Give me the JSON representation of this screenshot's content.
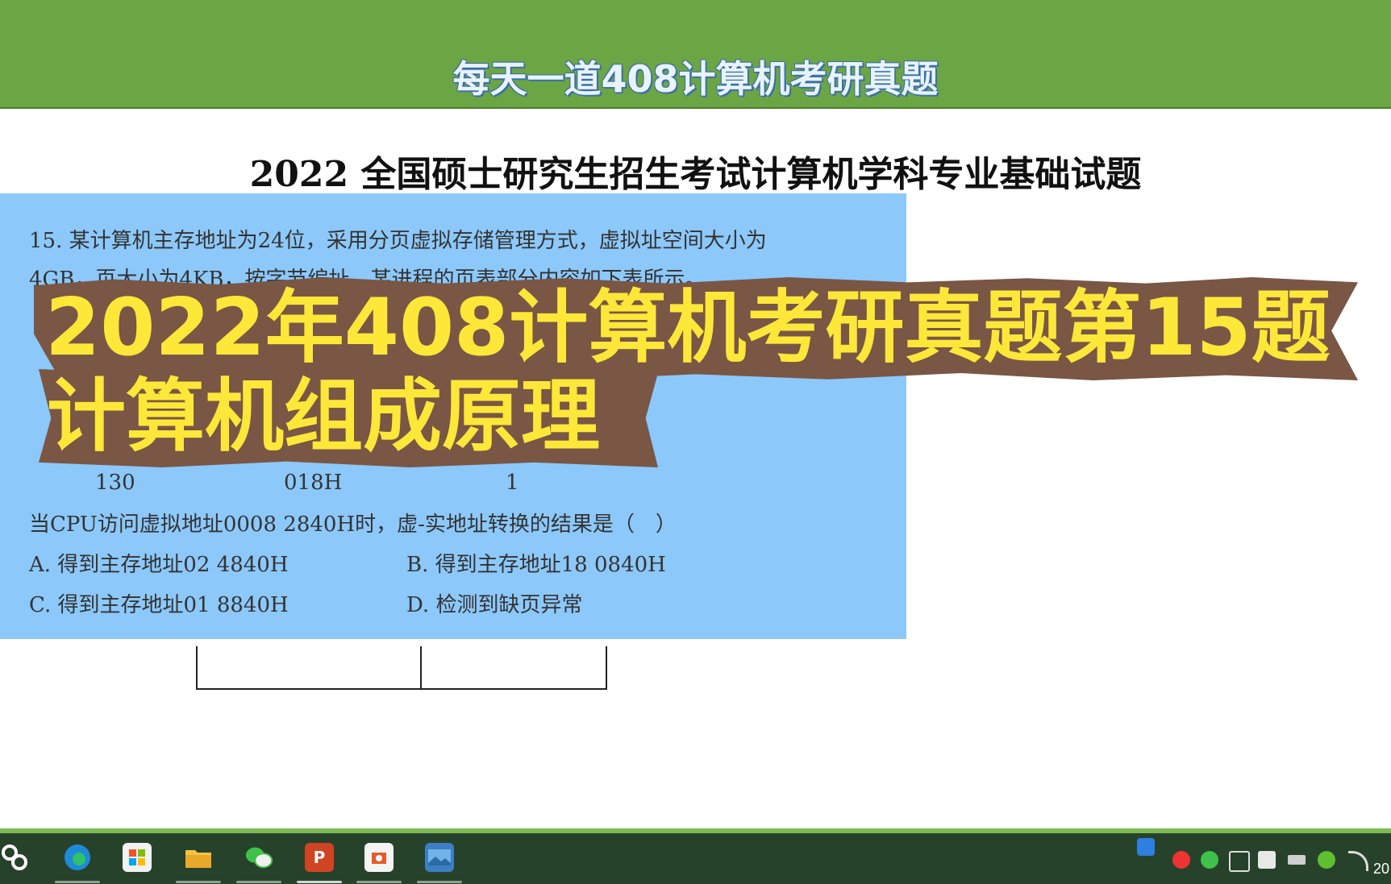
{
  "header": {
    "title": "每天一道408计算机考研真题"
  },
  "exam": {
    "title": "2022 全国硕士研究生招生考试计算机学科专业基础试题"
  },
  "question": {
    "line1": "15. 某计算机主存地址为24位，采用分页虚拟存储管理方式，虚拟址空间大小为",
    "line2": "4GB，页大小为4KB，按字节编址。某进程的页表部分内容如下表所示。",
    "table_row": {
      "page": "130",
      "frame": "018H",
      "valid": "1"
    },
    "prompt": "当CPU访问虚拟地址0008 2840H时，虚-实地址转换的结果是（　）",
    "options": {
      "a": "A. 得到主存地址02 4840H",
      "b": "B. 得到主存地址18 0840H",
      "c": "C. 得到主存地址01 8840H",
      "d": "D. 检测到缺页异常"
    }
  },
  "overlay": {
    "line1": "2022年408计算机考研真题第15题",
    "line2": "计算机组成原理"
  },
  "taskbar": {
    "apps": [
      {
        "name": "start-icon",
        "glyph": ""
      },
      {
        "name": "edge-icon",
        "glyph": ""
      },
      {
        "name": "store-icon",
        "glyph": ""
      },
      {
        "name": "file-explorer-icon",
        "glyph": ""
      },
      {
        "name": "wechat-icon",
        "glyph": ""
      },
      {
        "name": "powerpoint-icon",
        "glyph": "P"
      },
      {
        "name": "app-icon",
        "glyph": ""
      },
      {
        "name": "photos-icon",
        "glyph": ""
      }
    ],
    "clock": "20"
  },
  "colors": {
    "header_bg": "#6ca544",
    "panel_bg": "#8cc8fa",
    "overlay_bg": "#7a5645",
    "overlay_text": "#fde83a",
    "taskbar_bg": "#27422b"
  }
}
